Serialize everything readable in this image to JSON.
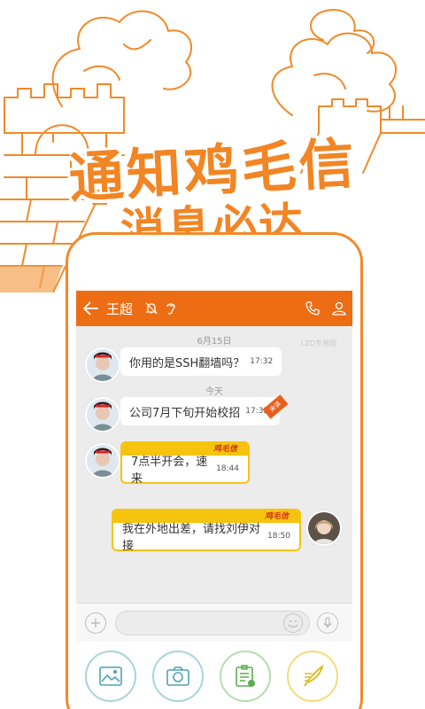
{
  "headline": {
    "line1": "通知鸡毛信",
    "line2": "消息必达"
  },
  "chat": {
    "contact_name": "王超",
    "watermark": "LZD专用版",
    "date_separators": [
      "6月15日",
      "今天"
    ],
    "messages": [
      {
        "text": "你用的是SSH翻墙吗？",
        "time": "17:32",
        "direction": "incoming"
      },
      {
        "text": "公司7月下旬开始校招",
        "time": "17:32",
        "direction": "incoming",
        "ribbon": "未读"
      },
      {
        "text": "7点半开会，速来",
        "time": "18:44",
        "direction": "incoming",
        "brand": "鸡毛信"
      },
      {
        "text": "我在外地出差，请找刘伊对接",
        "time": "18:50",
        "direction": "outgoing",
        "brand": "鸡毛信"
      }
    ],
    "input_placeholder": ""
  },
  "toolbar": {
    "buttons": [
      "picture-icon",
      "camera-icon",
      "notice-icon",
      "feather-icon"
    ]
  },
  "colors": {
    "accent": "#ec6d14",
    "brand_yellow": "#f6c40f",
    "frame_orange": "#f28a2c",
    "tool_ring": "#a8d4dc"
  }
}
